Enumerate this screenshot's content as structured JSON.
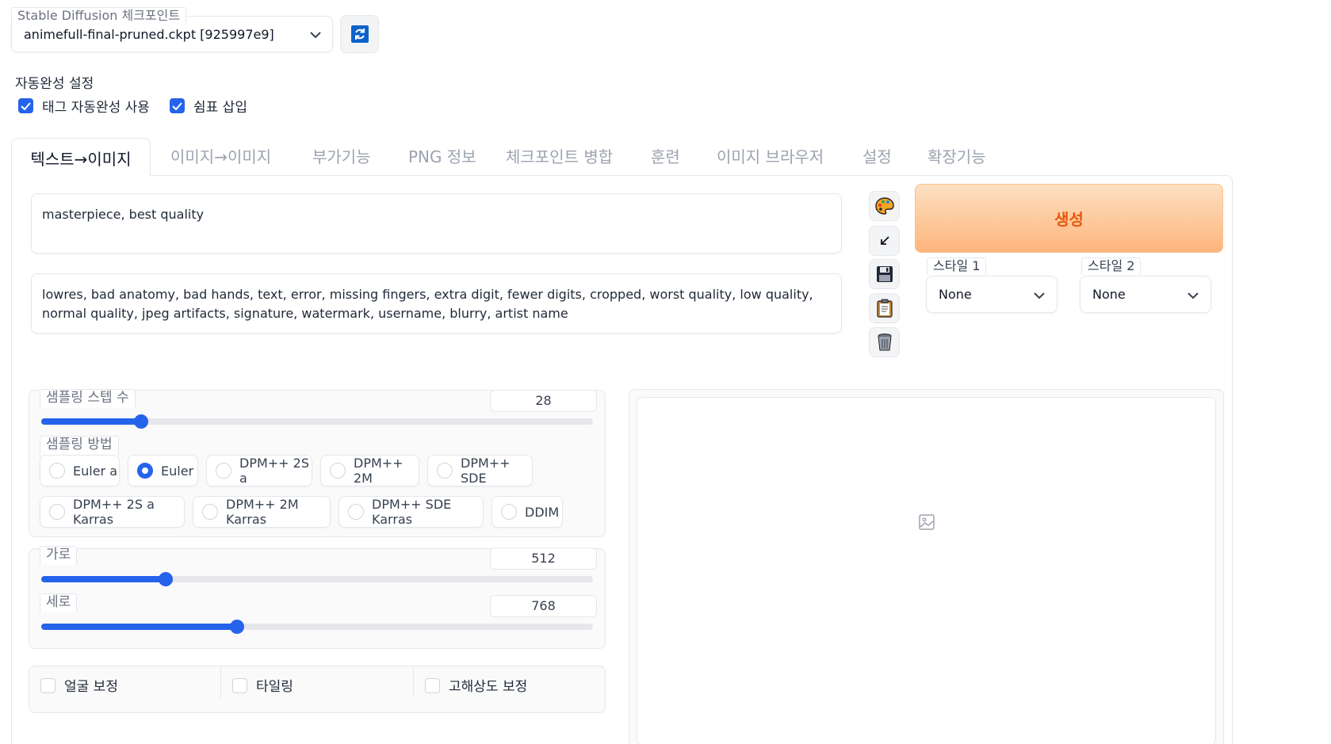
{
  "checkpoint": {
    "label": "Stable Diffusion 체크포인트",
    "value": "animefull-final-pruned.ckpt [925997e9]"
  },
  "autocomplete": {
    "title": "자동완성 설정",
    "options": [
      {
        "label": "태그 자동완성 사용",
        "checked": true
      },
      {
        "label": "쉼표 삽입",
        "checked": true
      }
    ]
  },
  "tabs": [
    "텍스트→이미지",
    "이미지→이미지",
    "부가기능",
    "PNG 정보",
    "체크포인트 병합",
    "훈련",
    "이미지 브라우저",
    "설정",
    "확장기능"
  ],
  "active_tab": "텍스트→이미지",
  "prompt": {
    "positive": "masterpiece, best quality",
    "negative": "lowres, bad anatomy, bad hands, text, error, missing fingers, extra digit, fewer digits, cropped, worst quality, low quality, normal quality, jpeg artifacts, signature, watermark, username, blurry, artist name"
  },
  "tools": [
    "palette-icon",
    "arrow-icon",
    "save-icon",
    "clipboard-icon",
    "trash-icon"
  ],
  "generate_label": "생성",
  "styles": [
    {
      "label": "스타일 1",
      "value": "None"
    },
    {
      "label": "스타일 2",
      "value": "None"
    }
  ],
  "steps": {
    "label": "샘플링 스텝 수",
    "value": "28",
    "min": 1,
    "max": 150
  },
  "sampler": {
    "label": "샘플링 방법",
    "selected": "Euler",
    "options": [
      "Euler a",
      "Euler",
      "DPM++ 2S a",
      "DPM++ 2M",
      "DPM++ SDE",
      "DPM++ 2S a Karras",
      "DPM++ 2M Karras",
      "DPM++ SDE Karras",
      "DDIM"
    ]
  },
  "width": {
    "label": "가로",
    "value": "512",
    "min": 64,
    "max": 2048
  },
  "height": {
    "label": "세로",
    "value": "768",
    "min": 64,
    "max": 2048
  },
  "options": [
    "얼굴 보정",
    "타일링",
    "고해상도 보정"
  ],
  "colors": {
    "accent": "#2563eb",
    "generate_text": "#ea580c"
  }
}
